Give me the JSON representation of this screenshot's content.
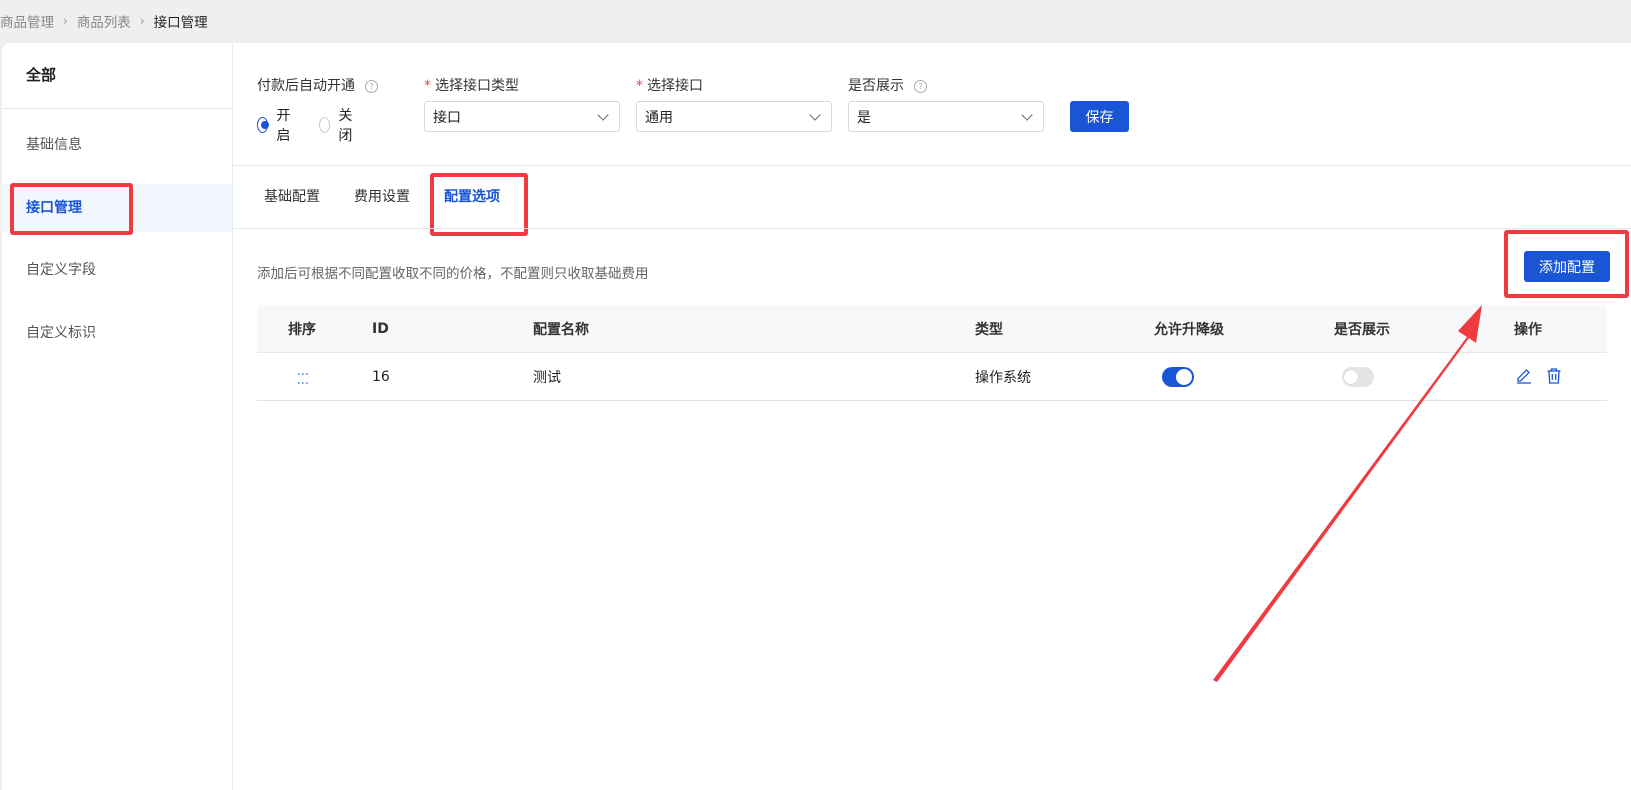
{
  "breadcrumb": {
    "items": [
      "商品管理",
      "商品列表"
    ],
    "current": "接口管理",
    "separator": "›"
  },
  "sidebar": {
    "title": "全部",
    "items": [
      {
        "label": "基础信息",
        "active": false
      },
      {
        "label": "接口管理",
        "active": true
      },
      {
        "label": "自定义字段",
        "active": false
      },
      {
        "label": "自定义标识",
        "active": false
      }
    ]
  },
  "form": {
    "auto_open": {
      "label": "付款后自动开通",
      "options": [
        "开启",
        "关闭"
      ],
      "selected": "开启"
    },
    "interface_type": {
      "label": "选择接口类型",
      "required": true,
      "value": "接口"
    },
    "interface": {
      "label": "选择接口",
      "required": true,
      "value": "通用"
    },
    "display": {
      "label": "是否展示",
      "value": "是"
    },
    "save_label": "保存",
    "help_glyph": "?"
  },
  "tabs": [
    {
      "label": "基础配置",
      "active": false
    },
    {
      "label": "费用设置",
      "active": false
    },
    {
      "label": "配置选项",
      "active": true
    }
  ],
  "description": "添加后可根据不同配置收取不同的价格，不配置则只收取基础费用",
  "add_config_label": "添加配置",
  "table": {
    "headers": [
      "排序",
      "ID",
      "配置名称",
      "类型",
      "允许升降级",
      "是否展示",
      "操作"
    ],
    "rows": [
      {
        "drag": "⋮⋮",
        "id": "16",
        "name": "测试",
        "type": "操作系统",
        "allow_upgrade": true,
        "display": false
      }
    ]
  },
  "colors": {
    "accent": "#1a55d6",
    "highlight": "#ef3a3f"
  }
}
